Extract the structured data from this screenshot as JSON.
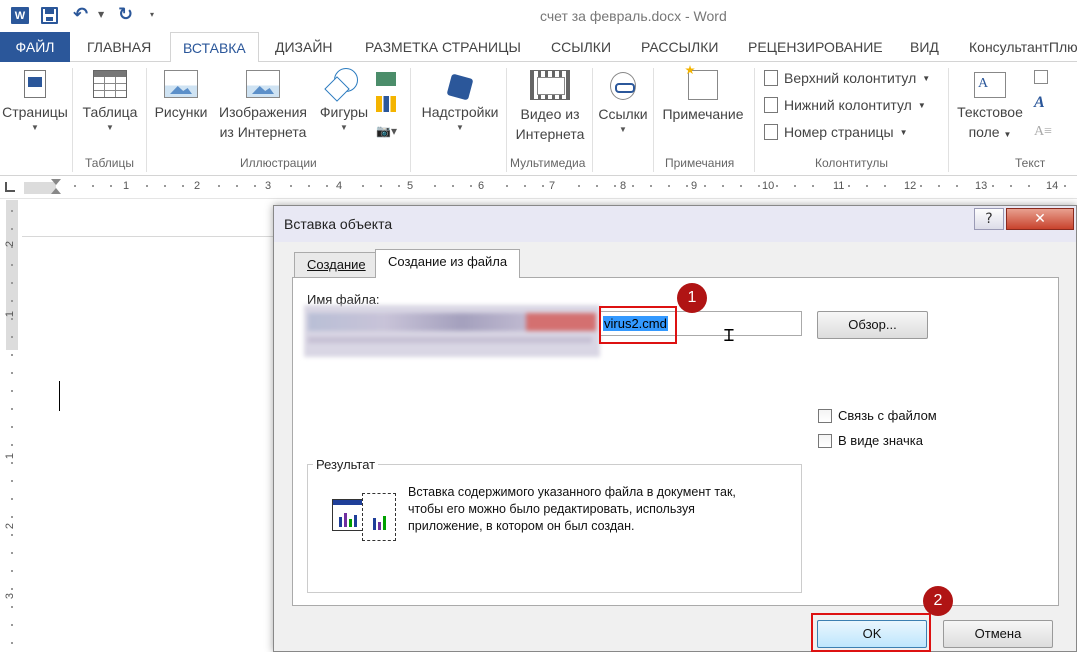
{
  "titlebar": {
    "doc_title": "счет за февраль.docx - Word",
    "word_logo": "W"
  },
  "tabs": [
    {
      "label": "ФАЙЛ"
    },
    {
      "label": "ГЛАВНАЯ"
    },
    {
      "label": "ВСТАВКА"
    },
    {
      "label": "ДИЗАЙН"
    },
    {
      "label": "РАЗМЕТКА СТРАНИЦЫ"
    },
    {
      "label": "ССЫЛКИ"
    },
    {
      "label": "РАССЫЛКИ"
    },
    {
      "label": "РЕЦЕНЗИРОВАНИЕ"
    },
    {
      "label": "ВИД"
    },
    {
      "label": "КонсультантПлю"
    }
  ],
  "ribbon": {
    "pages": "Страницы",
    "table": "Таблица",
    "pictures": "Рисунки",
    "online_pictures_1": "Изображения",
    "online_pictures_2": "из Интернета",
    "shapes": "Фигуры",
    "addins": "Надстройки",
    "video_1": "Видео из",
    "video_2": "Интернета",
    "links": "Ссылки",
    "comment": "Примечание",
    "header": "Верхний колонтитул",
    "footer": "Нижний колонтитул",
    "page_number": "Номер страницы",
    "textbox_1": "Текстовое",
    "textbox_2": "поле",
    "groups": {
      "tables": "Таблицы",
      "illustrations": "Иллюстрации",
      "multimedia": "Мультимедиа",
      "comments": "Примечания",
      "header_footer": "Колонтитулы",
      "text": "Текст"
    }
  },
  "ruler": {
    "numbers": [
      "1",
      "2",
      "3",
      "4",
      "5",
      "6",
      "7",
      "8",
      "9",
      "10",
      "11",
      "12",
      "13",
      "14"
    ],
    "vertical_numbers": [
      "2",
      "1",
      "1",
      "2",
      "3"
    ]
  },
  "dialog": {
    "title": "Вставка объекта",
    "help": "?",
    "close": "✕",
    "tab_create": "Создание",
    "tab_from_file": "Создание из файла",
    "filename_label": "Имя файла:",
    "filename_value": "virus2.cmd",
    "browse": "Обзор...",
    "link_to_file": "Связь с файлом",
    "display_as_icon": "В виде значка",
    "result_label": "Результат",
    "result_text": "Вставка содержимого указанного файла в документ так, чтобы его можно было редактировать, используя приложение, в котором он был создан.",
    "ok": "OK",
    "cancel": "Отмена"
  },
  "annotations": {
    "badge1": "1",
    "badge2": "2"
  },
  "colors": {
    "word_blue": "#2b579a",
    "annotation_red": "#d11111",
    "selection": "#3399ff"
  }
}
